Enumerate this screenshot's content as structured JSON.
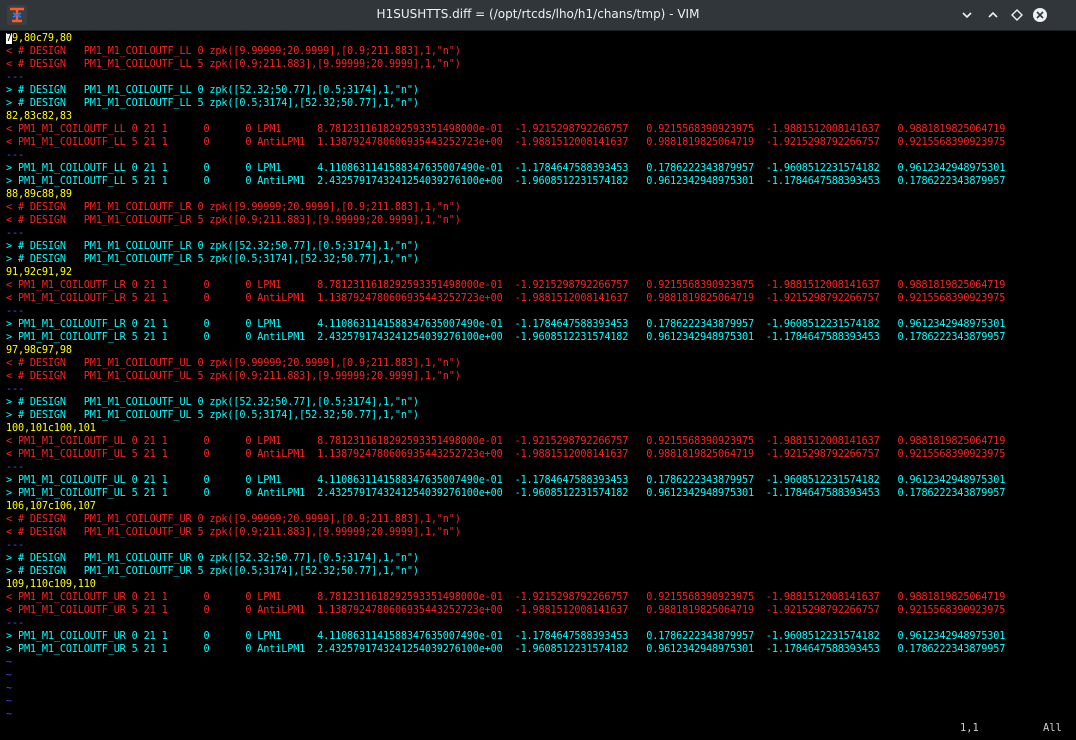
{
  "window": {
    "title": "H1SUSHTTS.diff = (/opt/rtcds/lho/h1/chans/tmp) - VIM",
    "buttons": [
      "help-icon",
      "minimize-icon",
      "maximize-icon",
      "close-icon"
    ]
  },
  "colors": {
    "delete": "#ff2020",
    "add": "#00ffff",
    "hunk": "#ffff00",
    "sep": "#5050ff",
    "tilde": "#4545ff"
  },
  "lines": [
    {
      "t": "79,80c79,80",
      "k": "hunk"
    },
    {
      "t": "< # DESIGN   PM1_M1_COILOUTF_LL 0 zpk([9.99999;20.9999],[0.9;211.883],1,\"n\")",
      "k": "del"
    },
    {
      "t": "< # DESIGN   PM1_M1_COILOUTF_LL 5 zpk([0.9;211.883],[9.99999;20.9999],1,\"n\")",
      "k": "del"
    },
    {
      "t": "---",
      "k": "sep"
    },
    {
      "t": "> # DESIGN   PM1_M1_COILOUTF_LL 0 zpk([52.32;50.77],[0.5;3174],1,\"n\")",
      "k": "add"
    },
    {
      "t": "> # DESIGN   PM1_M1_COILOUTF_LL 5 zpk([0.5;3174],[52.32;50.77],1,\"n\")",
      "k": "add"
    },
    {
      "t": "82,83c82,83",
      "k": "hunk"
    },
    {
      "t": "< PM1_M1_COILOUTF_LL 0 21 1      0      0 LPM1      8.7812311618292593351498000e-01  -1.9215298792266757   0.9215568390923975  -1.9881512008141637   0.9881819825064719",
      "k": "del"
    },
    {
      "t": "< PM1_M1_COILOUTF_LL 5 21 1      0      0 AntiLPM1  1.1387924780606935443252723e+00  -1.9881512008141637   0.9881819825064719  -1.9215298792266757   0.9215568390923975",
      "k": "del"
    },
    {
      "t": "---",
      "k": "sep"
    },
    {
      "t": "> PM1_M1_COILOUTF_LL 0 21 1      0      0 LPM1      4.1108631141588347635007490e-01  -1.1784647588393453   0.1786222343879957  -1.9608512231574182   0.9612342948975301",
      "k": "add"
    },
    {
      "t": "> PM1_M1_COILOUTF_LL 5 21 1      0      0 AntiLPM1  2.4325791743241254039276100e+00  -1.9608512231574182   0.9612342948975301  -1.1784647588393453   0.1786222343879957",
      "k": "add"
    },
    {
      "t": "88,89c88,89",
      "k": "hunk"
    },
    {
      "t": "< # DESIGN   PM1_M1_COILOUTF_LR 0 zpk([9.99999;20.9999],[0.9;211.883],1,\"n\")",
      "k": "del"
    },
    {
      "t": "< # DESIGN   PM1_M1_COILOUTF_LR 5 zpk([0.9;211.883],[9.99999;20.9999],1,\"n\")",
      "k": "del"
    },
    {
      "t": "---",
      "k": "sep"
    },
    {
      "t": "> # DESIGN   PM1_M1_COILOUTF_LR 0 zpk([52.32;50.77],[0.5;3174],1,\"n\")",
      "k": "add"
    },
    {
      "t": "> # DESIGN   PM1_M1_COILOUTF_LR 5 zpk([0.5;3174],[52.32;50.77],1,\"n\")",
      "k": "add"
    },
    {
      "t": "91,92c91,92",
      "k": "hunk"
    },
    {
      "t": "< PM1_M1_COILOUTF_LR 0 21 1      0      0 LPM1      8.7812311618292593351498000e-01  -1.9215298792266757   0.9215568390923975  -1.9881512008141637   0.9881819825064719",
      "k": "del"
    },
    {
      "t": "< PM1_M1_COILOUTF_LR 5 21 1      0      0 AntiLPM1  1.1387924780606935443252723e+00  -1.9881512008141637   0.9881819825064719  -1.9215298792266757   0.9215568390923975",
      "k": "del"
    },
    {
      "t": "---",
      "k": "sep"
    },
    {
      "t": "> PM1_M1_COILOUTF_LR 0 21 1      0      0 LPM1      4.1108631141588347635007490e-01  -1.1784647588393453   0.1786222343879957  -1.9608512231574182   0.9612342948975301",
      "k": "add"
    },
    {
      "t": "> PM1_M1_COILOUTF_LR 5 21 1      0      0 AntiLPM1  2.4325791743241254039276100e+00  -1.9608512231574182   0.9612342948975301  -1.1784647588393453   0.1786222343879957",
      "k": "add"
    },
    {
      "t": "97,98c97,98",
      "k": "hunk"
    },
    {
      "t": "< # DESIGN   PM1_M1_COILOUTF_UL 0 zpk([9.99999;20.9999],[0.9;211.883],1,\"n\")",
      "k": "del"
    },
    {
      "t": "< # DESIGN   PM1_M1_COILOUTF_UL 5 zpk([0.9;211.883],[9.99999;20.9999],1,\"n\")",
      "k": "del"
    },
    {
      "t": "---",
      "k": "sep"
    },
    {
      "t": "> # DESIGN   PM1_M1_COILOUTF_UL 0 zpk([52.32;50.77],[0.5;3174],1,\"n\")",
      "k": "add"
    },
    {
      "t": "> # DESIGN   PM1_M1_COILOUTF_UL 5 zpk([0.5;3174],[52.32;50.77],1,\"n\")",
      "k": "add"
    },
    {
      "t": "100,101c100,101",
      "k": "hunk"
    },
    {
      "t": "< PM1_M1_COILOUTF_UL 0 21 1      0      0 LPM1      8.7812311618292593351498000e-01  -1.9215298792266757   0.9215568390923975  -1.9881512008141637   0.9881819825064719",
      "k": "del"
    },
    {
      "t": "< PM1_M1_COILOUTF_UL 5 21 1      0      0 AntiLPM1  1.1387924780606935443252723e+00  -1.9881512008141637   0.9881819825064719  -1.9215298792266757   0.9215568390923975",
      "k": "del"
    },
    {
      "t": "---",
      "k": "sep"
    },
    {
      "t": "> PM1_M1_COILOUTF_UL 0 21 1      0      0 LPM1      4.1108631141588347635007490e-01  -1.1784647588393453   0.1786222343879957  -1.9608512231574182   0.9612342948975301",
      "k": "add"
    },
    {
      "t": "> PM1_M1_COILOUTF_UL 5 21 1      0      0 AntiLPM1  2.4325791743241254039276100e+00  -1.9608512231574182   0.9612342948975301  -1.1784647588393453   0.1786222343879957",
      "k": "add"
    },
    {
      "t": "106,107c106,107",
      "k": "hunk"
    },
    {
      "t": "< # DESIGN   PM1_M1_COILOUTF_UR 0 zpk([9.99999;20.9999],[0.9;211.883],1,\"n\")",
      "k": "del"
    },
    {
      "t": "< # DESIGN   PM1_M1_COILOUTF_UR 5 zpk([0.9;211.883],[9.99999;20.9999],1,\"n\")",
      "k": "del"
    },
    {
      "t": "---",
      "k": "sep"
    },
    {
      "t": "> # DESIGN   PM1_M1_COILOUTF_UR 0 zpk([52.32;50.77],[0.5;3174],1,\"n\")",
      "k": "add"
    },
    {
      "t": "> # DESIGN   PM1_M1_COILOUTF_UR 5 zpk([0.5;3174],[52.32;50.77],1,\"n\")",
      "k": "add"
    },
    {
      "t": "109,110c109,110",
      "k": "hunk"
    },
    {
      "t": "< PM1_M1_COILOUTF_UR 0 21 1      0      0 LPM1      8.7812311618292593351498000e-01  -1.9215298792266757   0.9215568390923975  -1.9881512008141637   0.9881819825064719",
      "k": "del"
    },
    {
      "t": "< PM1_M1_COILOUTF_UR 5 21 1      0      0 AntiLPM1  1.1387924780606935443252723e+00  -1.9881512008141637   0.9881819825064719  -1.9215298792266757   0.9215568390923975",
      "k": "del"
    },
    {
      "t": "---",
      "k": "sep"
    },
    {
      "t": "> PM1_M1_COILOUTF_UR 0 21 1      0      0 LPM1      4.1108631141588347635007490e-01  -1.1784647588393453   0.1786222343879957  -1.9608512231574182   0.9612342948975301",
      "k": "add"
    },
    {
      "t": "> PM1_M1_COILOUTF_UR 5 21 1      0      0 AntiLPM1  2.4325791743241254039276100e+00  -1.9608512231574182   0.9612342948975301  -1.1784647588393453   0.1786222343879957",
      "k": "add"
    }
  ],
  "tildes": [
    "~",
    "~",
    "~",
    "~",
    "~"
  ],
  "ruler": {
    "position": "1,1",
    "scroll": "All"
  }
}
